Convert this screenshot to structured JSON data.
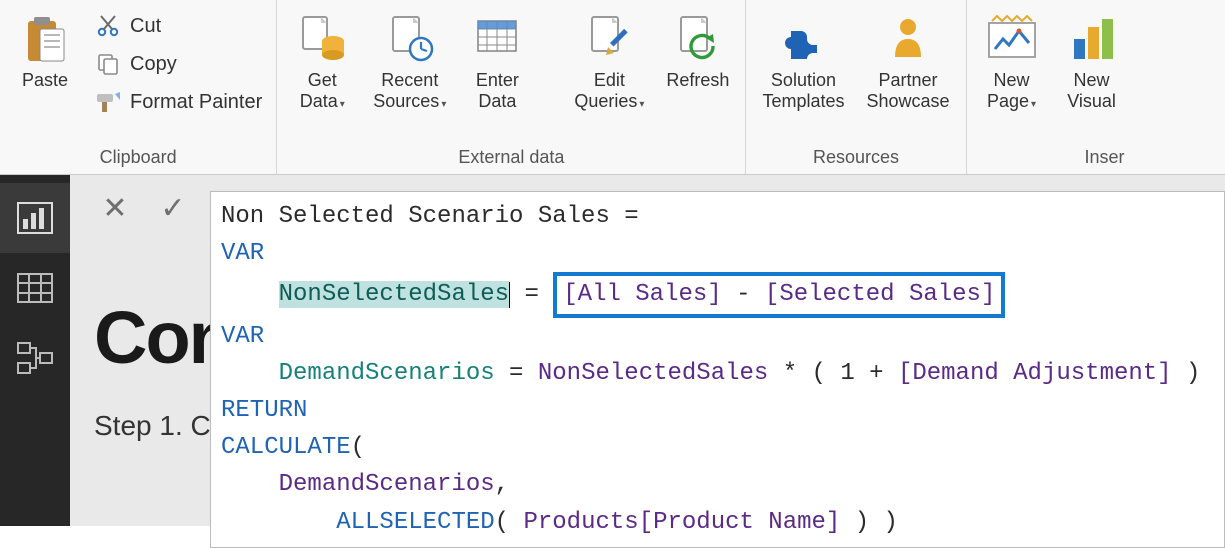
{
  "ribbon": {
    "groups": {
      "clipboard": {
        "label": "Clipboard",
        "paste": "Paste",
        "cut": "Cut",
        "copy": "Copy",
        "format_painter": "Format Painter"
      },
      "external": {
        "label": "External data",
        "get_data": "Get\nData",
        "recent_sources": "Recent\nSources",
        "enter_data": "Enter\nData",
        "edit_queries": "Edit\nQueries",
        "refresh": "Refresh"
      },
      "resources": {
        "label": "Resources",
        "solution_templates": "Solution\nTemplates",
        "partner_showcase": "Partner\nShowcase"
      },
      "insert": {
        "label": "Inser",
        "new_page": "New\nPage",
        "new_visual": "New\nVisual"
      }
    }
  },
  "formula_bar": {
    "cancel": "✕",
    "commit": "✓"
  },
  "formula": {
    "line1_a": "Non Selected Scenario Sales = ",
    "var_kw": "VAR",
    "return_kw": "RETURN",
    "calculate_kw": "CALCULATE",
    "allselected_kw": "ALLSELECTED",
    "nonSelectedSales_decl": "NonSelectedSales",
    "nonSelectedSales_expr_all": "[All Sales]",
    "nonSelectedSales_expr_sel": "[Selected Sales]",
    "demandScenarios_decl": "DemandScenarios",
    "nonSelectedSales_use": "NonSelectedSales",
    "demand_adj": "[Demand Adjustment]",
    "demandScenarios_use": "DemandScenarios",
    "products_ref": "Products[Product Name]"
  },
  "canvas": {
    "title_fragment": "Con",
    "step_fragment": "Step 1. C"
  }
}
